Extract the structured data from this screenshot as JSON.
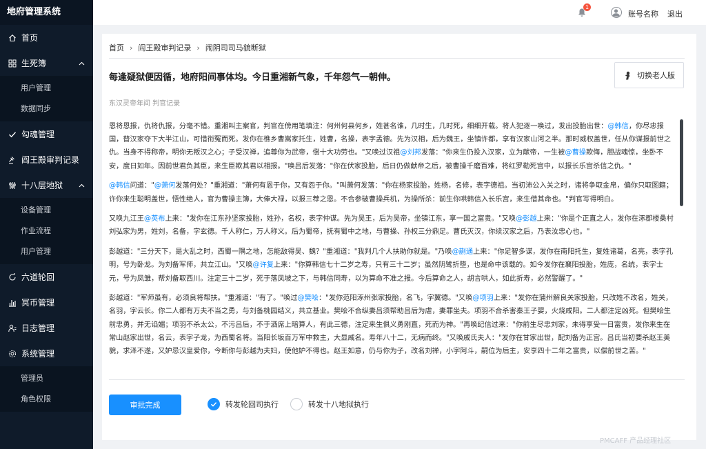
{
  "app": {
    "title": "地府管理系统"
  },
  "sidebar": {
    "items": [
      {
        "label": "首页"
      },
      {
        "label": "生死簿"
      },
      {
        "label": "用户管理"
      },
      {
        "label": "数据同步"
      },
      {
        "label": "勾魂管理"
      },
      {
        "label": "阎王殿审判记录"
      },
      {
        "label": "十八层地狱"
      },
      {
        "label": "设备管理"
      },
      {
        "label": "作业流程"
      },
      {
        "label": "用户管理"
      },
      {
        "label": "六道轮回"
      },
      {
        "label": "冥币管理"
      },
      {
        "label": "日志管理"
      },
      {
        "label": "系统管理"
      },
      {
        "label": "管理员"
      },
      {
        "label": "角色权限"
      }
    ]
  },
  "header": {
    "notification_count": "1",
    "account": "账号名称",
    "logout": "退出"
  },
  "breadcrumb": [
    "首页",
    "阎王殿审判记录",
    "闹阴司司马貌断狱"
  ],
  "page": {
    "title": "每逢疑狱便因循，地府阳间事体均。今日重湘新气象，千年怨气一朝伸。",
    "switch_label": "切换老人版",
    "subtitle": "东汉灵帝年间 判官记录"
  },
  "article": [
    [
      {
        "t": "恩将恩报，仇将仇报，分毫不错。重湘叫主案官，判官在傍用笔填注：何州何县何乡，姓甚名谁，几时生，几时死，细细开载。将人犯逐一唤过，发出投胎出世："
      },
      {
        "t": "@韩信",
        "m": true
      },
      {
        "t": "，你尽忠报国，替汉家夺下大半江山，可惜衔冤而死。发你在樵乡曹嵩家托生，姓曹，名操，表字孟德。先为汉相，后为魏王，坐镇许都，享有汉家山河之半。那时威权盖世，任从你谋报前世之仇。当身不得称帝，明你无叛汉之心；子受汉禅，追尊你为武帝，偿十大功劳也。"
      },
      {
        "t": "\"又唤过汉祖"
      },
      {
        "t": "@刘邦",
        "m": true
      },
      {
        "t": "发落："
      },
      {
        "t": "\"你来生仍投入汉家，立为献帝，一生被"
      },
      {
        "t": "@曹操",
        "m": true
      },
      {
        "t": "欺侮，胆战魂惊，坐卧不安，度日如年。因前世君负其臣，来生臣欺其君以相报。"
      },
      {
        "t": "\"唤吕后发落："
      },
      {
        "t": "\"你在伏家投胎，后日仍做献帝之后，被曹操千磨百难，将红罗勒死宫中，以报长乐宫杀信之仇。\""
      }
    ],
    [
      {
        "t": "@韩信",
        "m": true
      },
      {
        "t": "问道："
      },
      {
        "t": "\""
      },
      {
        "t": "@萧何",
        "m": true
      },
      {
        "t": "发落何处？\"重湘道：\"萧何有恩于你，又有怨于你。\"叫萧何发落：\"你在杨家投胎，姓杨，名修，表字德祖。当初沛公入关之时，诸将争取金帛，偏你只取图籍；许你来生聪明盖世，悟性绝人，官为曹操主簿，大俸大禄，以报三荐之恩。不合参破曹操兵机，为操所杀：前生你哄韩信入长乐宫，来生借其命也。\"判官写得明白。"
      }
    ],
    [
      {
        "t": "又唤九江王"
      },
      {
        "t": "@英布",
        "m": true
      },
      {
        "t": "上来：\"发你在江东孙坚家投胎，姓孙，名权，表字仲谋。先为吴王，后为吴帝，坐镇江东，享一国之富贵。\"又唤"
      },
      {
        "t": "@彭越",
        "m": true
      },
      {
        "t": "上来：\"你是个正直之人，发你在涿郡楼桑村刘弘家为男，姓刘，名备，字玄德。千人称仁，万人称义。后为蜀帝，抚有蜀中之地，与曹操、孙权三分鼎足。曹氏灭汉，你续汉家之后，乃表汝忠心也。\""
      }
    ],
    [
      {
        "t": "彭越道：\"三分天下，是大乱之时，西蜀一隅之地，怎能敌得吴、魏？\"重湘道：\"我判几个人扶助你就是。\"乃唤"
      },
      {
        "t": "@蒯通",
        "m": true
      },
      {
        "t": "上来：\"你足智多谋，发你在南阳托生，复姓诸葛，名亮，表字孔明，号为卧龙。为刘备军师，共立江山。\"又唤"
      },
      {
        "t": "@许复",
        "m": true
      },
      {
        "t": "上来：\"你算韩信七十二岁之寿，只有三十二岁；虽然阴骘折堕，也是命中该载的。如今发你在襄阳投胎，姓庞，名统，表字士元，号为凤雏，帮刘备取西川。注定三十二岁，死于落凤坡之下，与韩信同寿，以为算命不准之报。今后算命之人，胡言哄人，如此折寿，必然警醒了。\""
      }
    ],
    [
      {
        "t": "彭越道：\"军师虽有，必须良将帮扶。\"重湘道：\"有了。\"唤过"
      },
      {
        "t": "@樊哙",
        "m": true
      },
      {
        "t": "：\"发你范阳涿州张家投胎，名飞，字翼德。\"又唤"
      },
      {
        "t": "@项羽",
        "m": true
      },
      {
        "t": "上来：\"发你在蒲州解良关家投胎，只改姓不改名，姓关，名羽，字云长。你二人都有万夫不当之勇，与刘备桃园结义，共立基业。樊哙不合纵妻吕须帮助吕后为虐，妻罪坐夫。项羽不合杀害秦王子婴，火烧咸阳。二人都注定凶死。但樊哙生前忠勇，并无谄媚；项羽不杀太公，不污吕后，不于酒席上暗算人，有此三德，注定来生俱义勇刚直，死而为神。\"再唤纪信过来：\"你前生尽忠刘家，未得享受一日富贵，发你来生在常山赵家出世，名云，表字子龙，为西蜀名将。当阳长坂百万军中救主，大显威名。寿年八十二，无病而终。\"又唤戚氏夫人：\"发你在甘家出世，配刘备为正宫。吕氏当初要杀赵王美貌，求泽不遂，又妒忌汉皇爱你，今断你与彭越为夫妇，使他妒不得也。赵王如意，仍与你为子，改名刘禅，小字阿斗，嗣位为后主，安享四十二年之富贵，以偿前世之苦。\""
      }
    ]
  ],
  "actions": {
    "approve": "审批完成",
    "option_a": "转发轮回司执行",
    "option_b": "转发十八地狱执行"
  },
  "watermark": "PMCAFF 产品经理社区"
}
